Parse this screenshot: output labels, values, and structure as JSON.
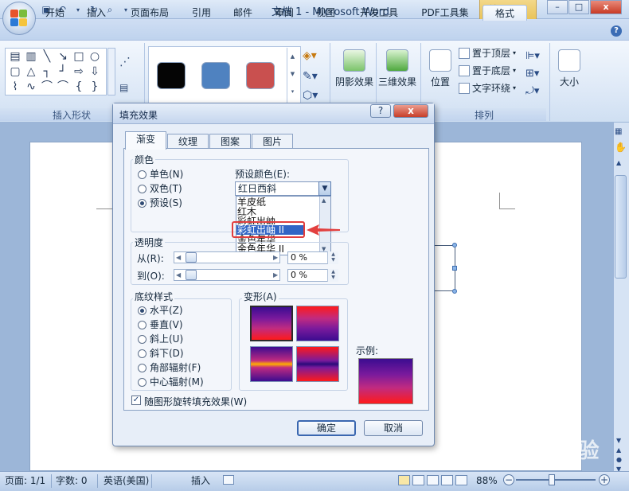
{
  "window": {
    "title": "文档 1 - Microsoft Word",
    "context_tab_group": "绘图工具",
    "controls": [
      "–",
      "□",
      "x"
    ]
  },
  "ribbon": {
    "tabs": [
      "开始",
      "插入",
      "页面布局",
      "引用",
      "邮件",
      "审阅",
      "视图",
      "开发工具",
      "PDF工具集",
      "格式"
    ],
    "active_tab": "格式",
    "groups": [
      "插入形状",
      "形状样式",
      "阴影效果",
      "三维效果",
      "排列",
      "大小"
    ],
    "buttons": {
      "shadow": "阴影效果",
      "threed": "三维效果",
      "position": "位置",
      "bring_front": "置于顶层",
      "send_back": "置于底层",
      "text_wrap": "文字环绕",
      "size": "大小",
      "arrange_group": "排列",
      "insert_shapes_group": "插入形状"
    },
    "style_swatch_colors": [
      "#050505",
      "#4f82c0",
      "#c9504f"
    ]
  },
  "dialog": {
    "title": "填充效果",
    "help": "?",
    "close": "x",
    "tabs": [
      "渐变",
      "纹理",
      "图案",
      "图片"
    ],
    "active_tab": "渐变",
    "colors": {
      "label": "颜色",
      "options": [
        "单色(N)",
        "双色(T)",
        "预设(S)"
      ],
      "selected": "预设(S)"
    },
    "preset": {
      "label": "预设颜色(E):",
      "value": "红日西斜",
      "list_items": [
        "羊皮纸",
        "红木",
        "彩虹出岫",
        "彩虹出岫 II",
        "金色年华",
        "金色年华 II"
      ],
      "selected_item": "彩虹出岫 II"
    },
    "transparency": {
      "label": "透明度",
      "from_label": "从(R):",
      "to_label": "到(O):",
      "from_value": "0 %",
      "to_value": "0 %"
    },
    "shading": {
      "label": "底纹样式",
      "options": [
        "水平(Z)",
        "垂直(V)",
        "斜上(U)",
        "斜下(D)",
        "角部辐射(F)",
        "中心辐射(M)"
      ],
      "selected": "水平(Z)"
    },
    "variants": {
      "label": "变形(A)"
    },
    "sample": {
      "label": "示例:"
    },
    "rotate_checkbox": {
      "label": "随图形旋转填充效果(W)",
      "checked": true
    },
    "ok": "确定",
    "cancel": "取消"
  },
  "statusbar": {
    "page": "页面: 1/1",
    "words": "字数: 0",
    "language": "英语(美国)",
    "mode": "插入",
    "zoom": "88%",
    "zoom_level": 0.88
  },
  "watermark": "Baidu 经验"
}
